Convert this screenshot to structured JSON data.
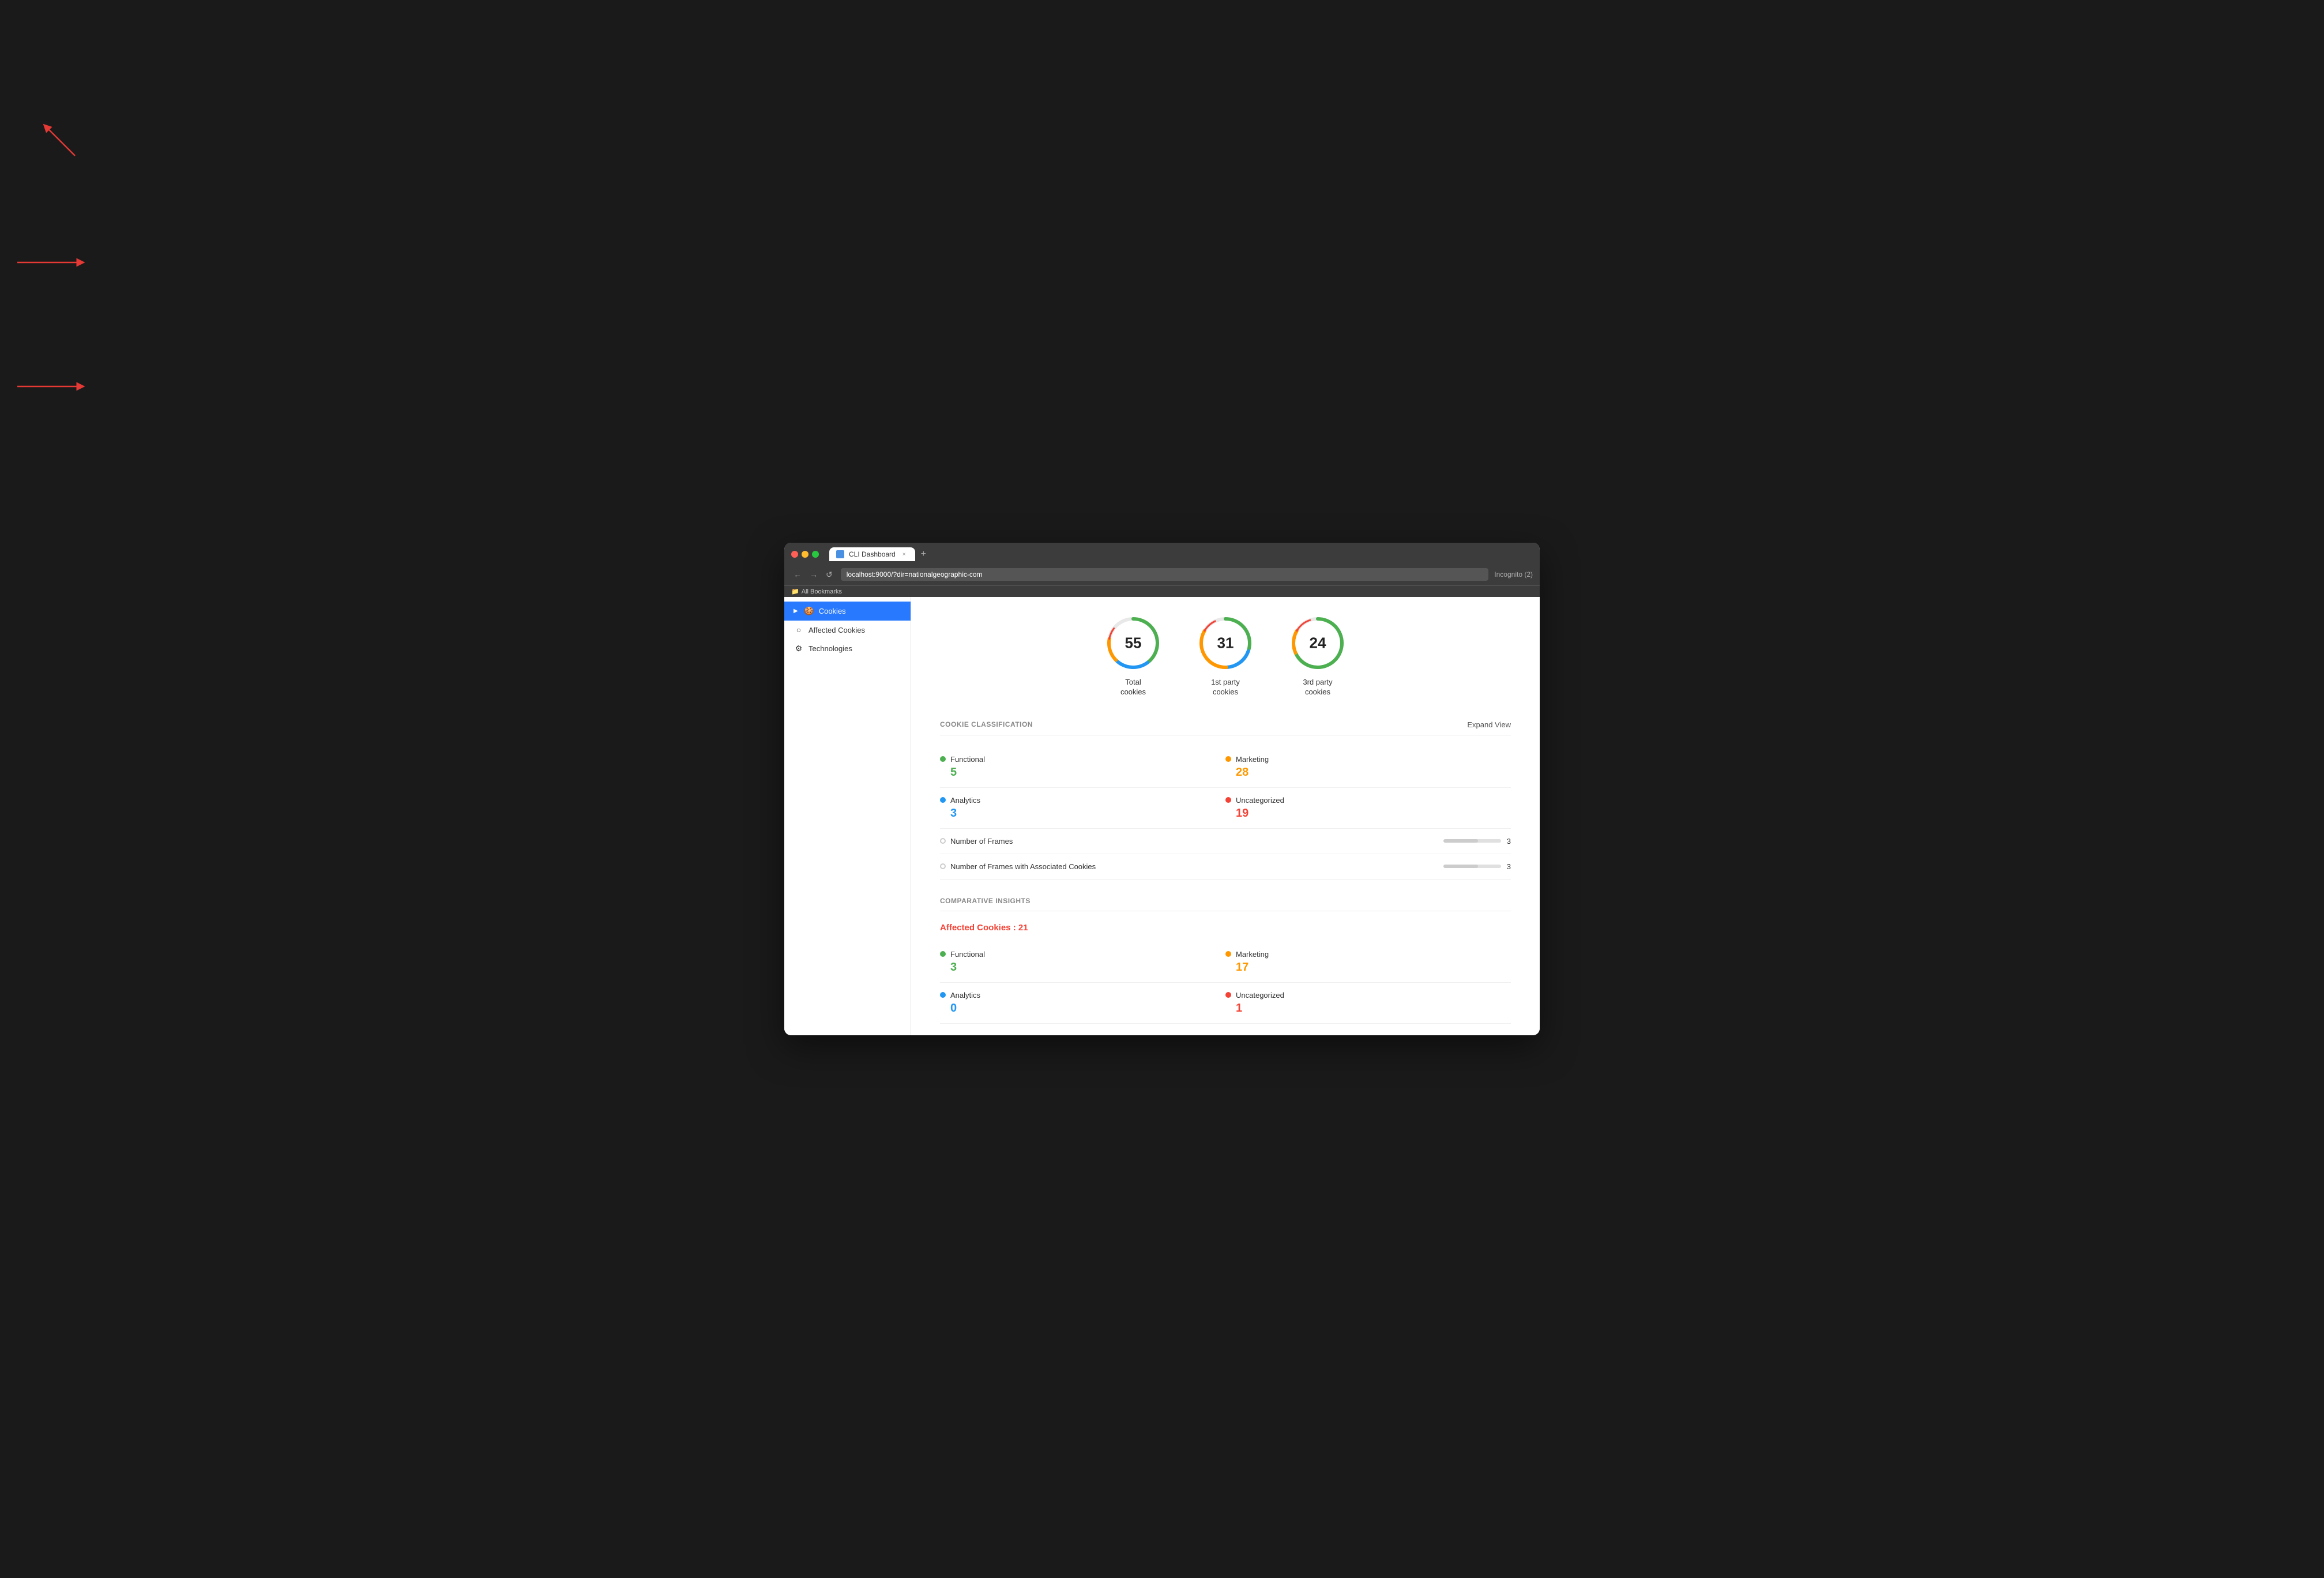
{
  "browser": {
    "tab_title": "CLI Dashboard",
    "url": "localhost:9000/?dir=nationalgeographic-com",
    "tab_new_label": "+",
    "nav_back": "←",
    "nav_forward": "→",
    "nav_reload": "↺",
    "incognito_label": "Incognito (2)",
    "bookmark_label": "All Bookmarks",
    "tab_close": "×"
  },
  "sidebar": {
    "items": [
      {
        "id": "cookies",
        "label": "Cookies",
        "icon": "🍪",
        "active": true
      },
      {
        "id": "affected-cookies",
        "label": "Affected Cookies",
        "icon": "○",
        "active": false
      },
      {
        "id": "technologies",
        "label": "Technologies",
        "icon": "⚙",
        "active": false
      }
    ]
  },
  "stats": [
    {
      "id": "total",
      "number": "55",
      "label": "Total\ncookies",
      "color": "multicolor"
    },
    {
      "id": "first-party",
      "number": "31",
      "label": "1st party\ncookies",
      "color": "multicolor"
    },
    {
      "id": "third-party",
      "number": "24",
      "label": "3rd party\ncookies",
      "color": "green"
    }
  ],
  "cookie_classification": {
    "section_title": "COOKIE CLASSIFICATION",
    "expand_label": "Expand View",
    "items": [
      {
        "id": "functional",
        "name": "Functional",
        "count": "5",
        "dot": "green",
        "count_color": "green"
      },
      {
        "id": "marketing",
        "name": "Marketing",
        "count": "28",
        "dot": "orange",
        "count_color": "orange"
      },
      {
        "id": "analytics",
        "name": "Analytics",
        "count": "3",
        "dot": "blue",
        "count_color": "blue"
      },
      {
        "id": "uncategorized",
        "name": "Uncategorized",
        "count": "19",
        "dot": "red",
        "count_color": "red"
      }
    ],
    "frames": [
      {
        "id": "num-frames",
        "label": "Number of Frames",
        "count": "3"
      },
      {
        "id": "num-frames-cookies",
        "label": "Number of Frames with Associated Cookies",
        "count": "3"
      }
    ]
  },
  "comparative_insights": {
    "section_title": "COMPARATIVE INSIGHTS",
    "affected_cookies_label": "Affected Cookies : 21",
    "items": [
      {
        "id": "functional",
        "name": "Functional",
        "count": "3",
        "dot": "green",
        "count_color": "green"
      },
      {
        "id": "marketing",
        "name": "Marketing",
        "count": "17",
        "dot": "orange",
        "count_color": "orange"
      },
      {
        "id": "analytics",
        "name": "Analytics",
        "count": "0",
        "dot": "blue",
        "count_color": "blue"
      },
      {
        "id": "uncategorized",
        "name": "Uncategorized",
        "count": "1",
        "dot": "red",
        "count_color": "red"
      }
    ]
  }
}
